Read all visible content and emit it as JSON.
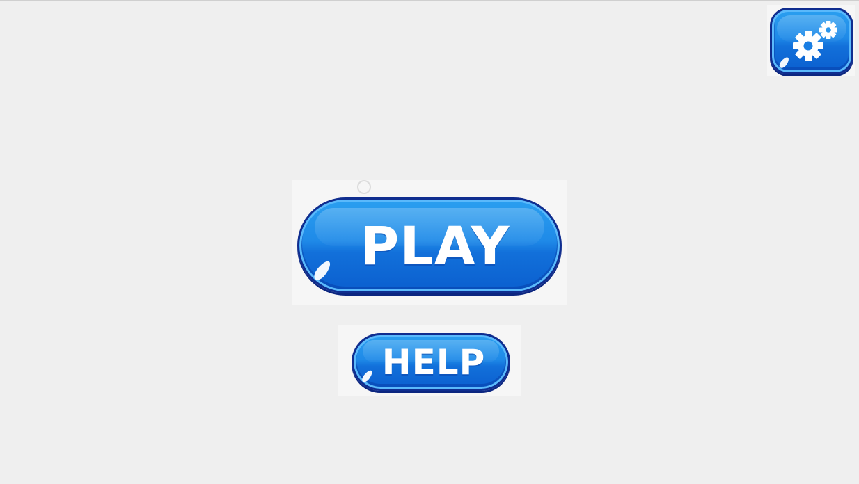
{
  "menu": {
    "play_label": "PLAY",
    "help_label": "HELP",
    "settings_icon": "gear-icon"
  },
  "colors": {
    "background": "#efefef",
    "button_fill": "#1f8ae8",
    "button_border": "#0f2d8f",
    "label": "#ffffff"
  }
}
